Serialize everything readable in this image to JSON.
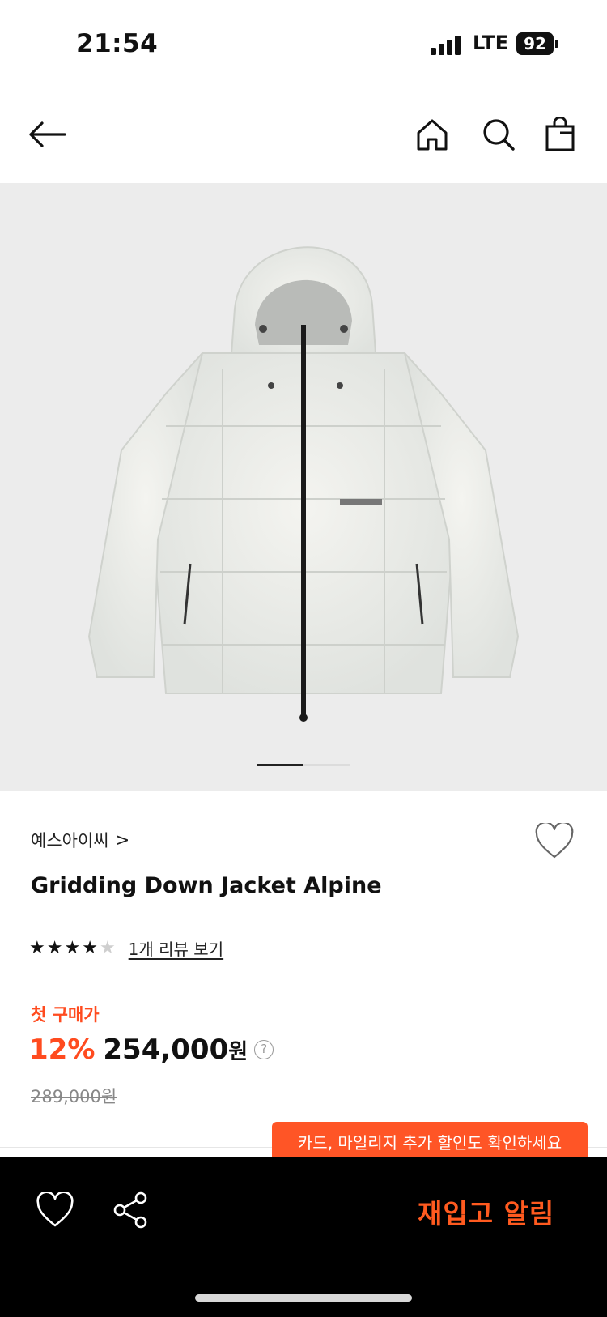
{
  "status_bar": {
    "time": "21:54",
    "network": "LTE",
    "battery": "92"
  },
  "nav": {
    "back_icon": "arrow-left-icon",
    "home_icon": "home-icon",
    "search_icon": "search-icon",
    "bag_icon": "shopping-bag-icon"
  },
  "gallery": {
    "image_alt": "Gridding Down Jacket Alpine product photo",
    "current_page": 1,
    "total_pages": 2
  },
  "product": {
    "brand": "예스아이씨",
    "brand_chevron": ">",
    "name": "Gridding Down Jacket Alpine",
    "rating_stars": 4,
    "rating_max": 5,
    "review_link": "1개 리뷰 보기",
    "first_purchase_label": "첫 구매가",
    "discount": "12%",
    "price": "254,000",
    "currency": "원",
    "help": "?",
    "original_price": "289,000원"
  },
  "promo_tooltip": "카드, 마일리지 추가 할인도 확인하세요",
  "bottom_bar": {
    "wish_icon": "heart-icon",
    "share_icon": "share-icon",
    "restock_button": "재입고 알림"
  },
  "colors": {
    "accent": "#ff4b1f",
    "bottom_bar": "#000000",
    "tooltip": "#ff5526"
  }
}
